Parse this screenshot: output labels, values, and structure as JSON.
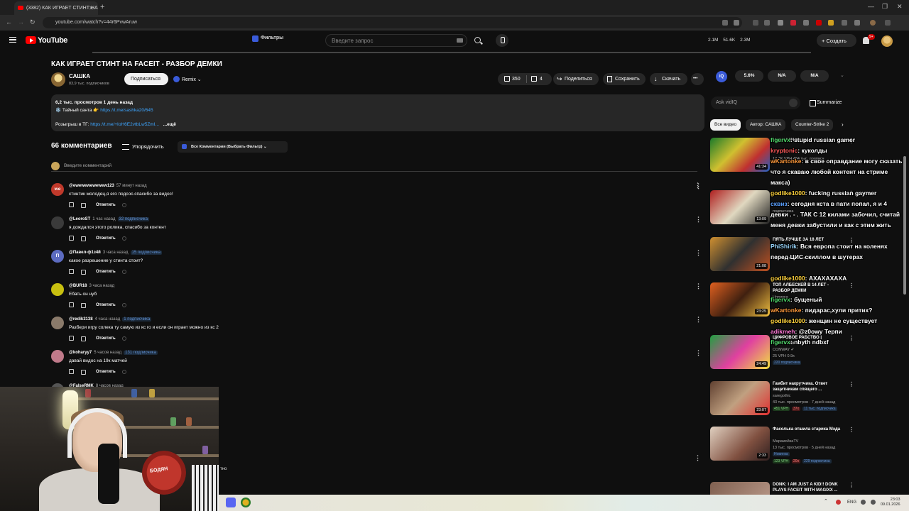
{
  "browser": {
    "tab_title": "(3382) КАК ИГРАЕТ СТИНТ НА",
    "tab_close": "✕",
    "new_tab": "+",
    "url": "youtube.com/watch?v=44r6PvwAruw",
    "win_min": "—",
    "win_max": "❐",
    "win_close": "✕"
  },
  "header": {
    "logo_text": "YouTube",
    "filters_label": "Фильтры",
    "search_placeholder": "Введите запрос",
    "stats": [
      "2.1M",
      "51.6K",
      "2.3M"
    ],
    "create_label": "+ Создать",
    "notif_badge": "9+"
  },
  "video": {
    "title": "КАК ИГРАЕТ СТИНТ НА FACEIT - РАЗБОР ДЕМКИ",
    "channel_name": "САШКА",
    "channel_subs": "83,9 тыс. подписчиков",
    "subscribe_label": "Подписаться",
    "remix_label": "Remix ⌄",
    "likes": "350",
    "dislikes": "4",
    "share_label": "Поделиться",
    "save_label": "Сохранить",
    "download_label": "Скачать",
    "more_label": "•••",
    "desc_stats": "6,2 тыс. просмотров  1 день назад",
    "desc_line1_prefix": "❄️ Тайный санта 👉 ",
    "desc_line1_link": "https://t.me/sashka20/645",
    "desc_line2_prefix": "Розыгрыш в ТГ: ",
    "desc_line2_link": "https://t.me/+IoH6E2vtbLw5ZmI...",
    "desc_more": "...ещё"
  },
  "comments": {
    "count_label": "66 комментариев",
    "sort_label": "Упорядочить",
    "filter_label": "Все Комментарии (Выбрать Фильтр)  ⌄",
    "add_placeholder": "Введите комментарий",
    "reply_label": "Ответить",
    "items": [
      {
        "author": "@ewewewewewew123",
        "time": "57 минут назад",
        "badge": "",
        "text": "стинтик молодец,я его подсос.спасибо за видос!",
        "avatar_text": "we",
        "avatar_color": "#c0392b"
      },
      {
        "author": "@LeoroST",
        "time": "1 час назад",
        "badge": "32 подписчика",
        "text": "я дождался этого ролика, спасибо за контент",
        "avatar_text": "",
        "avatar_color": "#3a3a3a"
      },
      {
        "author": "@Павел-ф1з4й",
        "time": "3 часа назад",
        "badge": "15 подписчика",
        "text": "какое разрешение у стинта стоит?",
        "avatar_text": "П",
        "avatar_color": "#5c6bc0"
      },
      {
        "author": "@BUR18",
        "time": "3 часа назад",
        "badge": "",
        "text": "Ебать он нуб",
        "avatar_text": "",
        "avatar_color": "#c8c010"
      },
      {
        "author": "@redik3138",
        "time": "4 часа назад",
        "badge": "1 подписчика",
        "text": "Разбери игру солека ту самую из кс го и если он играет можно из кс 2",
        "avatar_text": "",
        "avatar_color": "#8a7a6a"
      },
      {
        "author": "@koharyy7",
        "time": "5 часов назад",
        "badge": "131 подписчика",
        "text": "давай видос на 19к матчей",
        "avatar_text": "",
        "avatar_color": "#c07a8a"
      },
      {
        "author": "@FalseRMK",
        "time": "8 часов назад",
        "badge": "",
        "text": "",
        "avatar_text": "",
        "avatar_color": "#555"
      }
    ]
  },
  "vidiq": {
    "logo": "iQ",
    "stats": [
      "5.6%",
      "N/A",
      "N/A"
    ],
    "ask_placeholder": "Ask vidIQ",
    "summarize_label": "Summarize"
  },
  "chips": [
    "Все видео",
    "Автор: САШКА",
    "Counter-Strike 2"
  ],
  "related": [
    {
      "title": "ИНДУСТРИЯ 2",
      "channel": "TheNR2",
      "meta": "12,7K VPH  484 тыс. подписч",
      "duration": "41:34"
    },
    {
      "title": "",
      "channel": "SAMO",
      "meta": "подписчика",
      "duration": "13:09"
    },
    {
      "title": "ПЯТЬ ЛУЧШЕ ЗА 18 ЛЕТ",
      "channel": "",
      "meta": "1,6 тыс. подписчика",
      "duration": "21:08"
    },
    {
      "title": "ТОП АЛБЕСКЕЙ В 14 ЛЕТ - РАЗБОР ДЕМКИ",
      "channel": "Новинка",
      "meta": "",
      "duration": "23:25"
    },
    {
      "title": "ЦИФРОВОЕ РАБСТВО | Анибисмо",
      "channel": "CONWAY ✔",
      "meta": "25 VPH  0.9x",
      "tags": [
        "220 подписчика"
      ],
      "duration": "24:49"
    },
    {
      "title": "Гамбит накрутчика. Ответ защитникам спящего ...",
      "channel": "saregothic",
      "meta": "43 тыс. просмотров · 7 дней назад",
      "tags": [
        "451 VPH",
        "37x",
        "11 тыс. подписчика"
      ],
      "duration": "23:07"
    },
    {
      "title": "Фасолька отшила старика Мэда",
      "channel": "МарамойкаTV",
      "meta": "13 тыс. просмотров · 5 дней назад",
      "tags": [
        "Новинка"
      ],
      "tags2": [
        "123 VPH",
        "20x",
        "229 подписчика"
      ],
      "duration": "2:33"
    },
    {
      "title": "DONK: I AM JUST A KID!! DONK PLAYS FACEIT WITH MAGIXX ...",
      "channel": "",
      "meta": "",
      "duration": ""
    }
  ],
  "chat": [
    {
      "user": "figervx",
      "user_color": "#4fd86a",
      "msg": ": stupid russian gamer"
    },
    {
      "user": "kryptonic",
      "user_color": "#ff5a5a",
      "msg": ": куколды"
    },
    {
      "user": "wKartonke",
      "user_color": "#ff9a3c",
      "msg": ": в свое оправдание могу сказать что я скаваю любой контент на стриме макса)"
    },
    {
      "user": "godlike1000",
      "user_color": "#ffd23c",
      "msg": ": fucking russian gaymer"
    },
    {
      "user": "сквиз",
      "user_color": "#5aa0ff",
      "msg": ": сегодня кста в пати попал, я и 4 девки . - . ТАК С 12 килами забочил, считай меня девки забустили и как с этим жить"
    },
    {
      "user": "PhiShirik",
      "user_color": "#9ad8ff",
      "msg": ": Вся европа стоит на коленях перед ЦИС скиллом в шутерах"
    },
    {
      "user": "godlike1000",
      "user_color": "#ffd23c",
      "msg": ": АХАХАХАХА"
    },
    {
      "user": "figervx",
      "user_color": "#4fd86a",
      "msg": ": бущеный"
    },
    {
      "user": "wKartonke",
      "user_color": "#ff9a3c",
      "msg": ": пидарас,хули притих?"
    },
    {
      "user": "godlike1000",
      "user_color": "#ffd23c",
      "msg": ": женщин не существует"
    },
    {
      "user": "adikmeh",
      "user_color": "#ff7ad8",
      "msg": ": @z0owy Терпи"
    },
    {
      "user": "figervx",
      "user_color": "#4fd86a",
      "msg": ": nbyth ndbxf"
    }
  ],
  "webcam": {
    "mic_logo": "БОДЯН",
    "caption": "тно"
  },
  "taskbar": {
    "lang": "ENG",
    "time": "23:03",
    "date": "09.01.2026"
  },
  "colors": {
    "accent_red": "#ff0000",
    "link_blue": "#3ea6ff",
    "vidiq_blue": "#3a5bd9"
  }
}
